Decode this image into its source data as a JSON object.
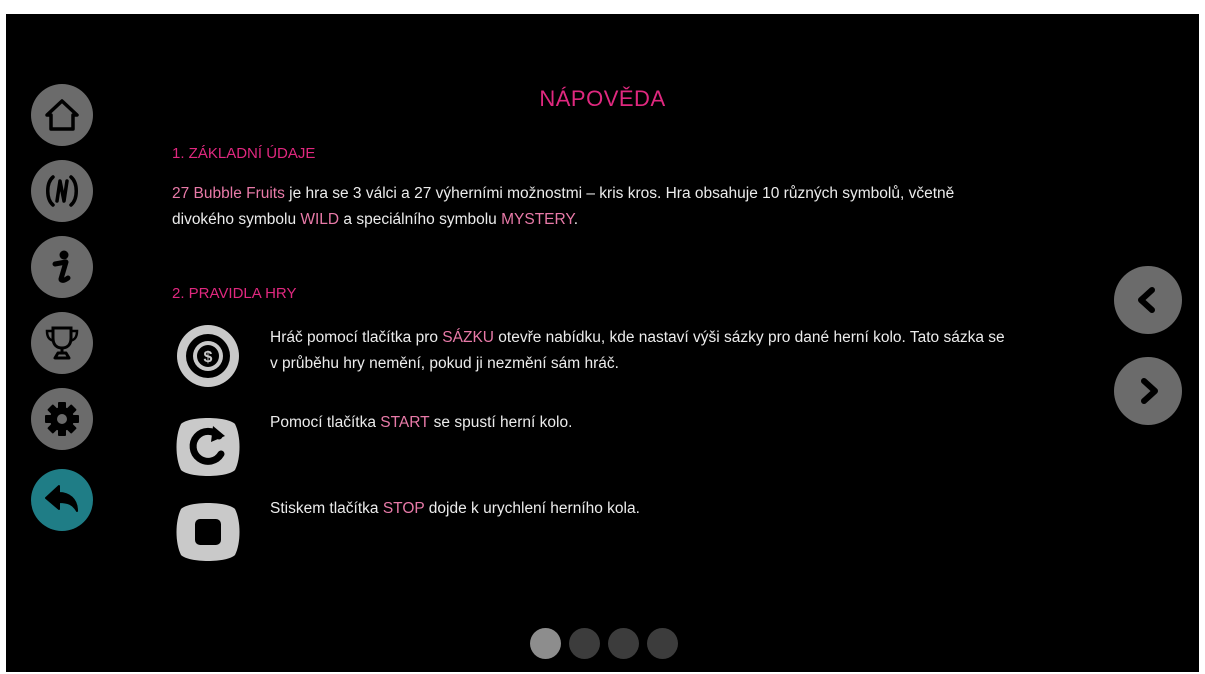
{
  "title": "NÁPOVĚDA",
  "section1": {
    "heading": "1. ZÁKLADNÍ ÚDAJE",
    "line1_game": "27 Bubble Fruits",
    "line1_rest": " je hra se 3 válci a 27 výherními možnostmi – kris kros. Hra obsahuje 10 různých symbolů, včetně",
    "line2_a": "divokého symbolu ",
    "line2_wild": "WILD",
    "line2_b": " a speciálního symbolu ",
    "line2_mystery": "MYSTERY",
    "line2_c": "."
  },
  "section2": {
    "heading": "2. PRAVIDLA HRY",
    "bet": {
      "a": "Hráč pomocí tlačítka pro ",
      "keyword": "SÁZKU",
      "b": " otevře nabídku, kde nastaví výši sázky pro dané herní kolo. Tato sázka se",
      "c": "v průběhu hry nemění, pokud ji nezmění sám hráč."
    },
    "start": {
      "a": "Pomocí tlačítka ",
      "keyword": "START",
      "b": " se spustí herní kolo."
    },
    "stop": {
      "a": "Stiskem tlačítka ",
      "keyword": "STOP",
      "b": " dojde k urychlení herního kola."
    }
  },
  "sidebar": {
    "items": [
      {
        "icon": "home-icon"
      },
      {
        "icon": "paytable-icon"
      },
      {
        "icon": "info-icon"
      },
      {
        "icon": "trophy-icon"
      },
      {
        "icon": "settings-gear-icon"
      },
      {
        "icon": "back-arrow-icon",
        "active": true
      }
    ]
  },
  "pagination": {
    "pages": 4,
    "current": 1
  },
  "colors": {
    "accent": "#e0287f",
    "highlight": "#e87aa8",
    "active": "#1f7d86",
    "button": "#6b6b6b"
  }
}
